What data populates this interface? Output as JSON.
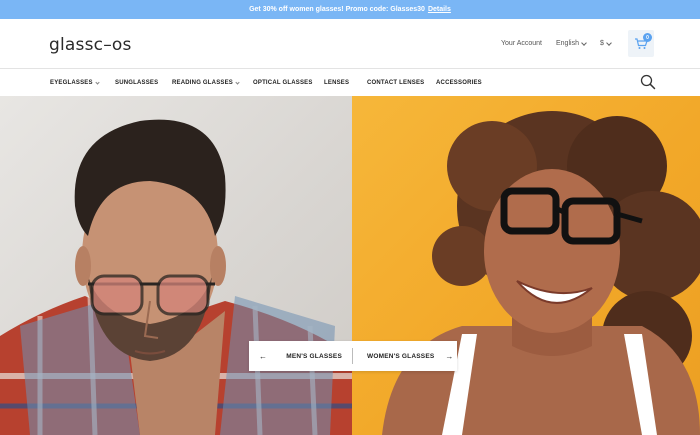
{
  "promo": {
    "text": "Get 30% off women glasses! Promo code: Glasses30",
    "link": "Details"
  },
  "header": {
    "logo": "glassc–os",
    "account": "Your Account",
    "language": "English",
    "currency": "$",
    "cart_count": "0"
  },
  "nav": {
    "items": [
      {
        "label": "EYEGLASSES",
        "dropdown": true
      },
      {
        "label": "SUNGLASSES",
        "dropdown": false
      },
      {
        "label": "READING GLASSES",
        "dropdown": true
      },
      {
        "label": "OPTICAL GLASSES",
        "dropdown": false
      },
      {
        "label": "LENSES",
        "dropdown": false
      },
      {
        "label": "CONTACT LENSES",
        "dropdown": false
      },
      {
        "label": "ACCESSORIES",
        "dropdown": false
      }
    ]
  },
  "hero": {
    "left_button": "MEN'S GLASSES",
    "left_arrow": "←",
    "right_button": "WOMEN'S GLASSES",
    "right_arrow": "→"
  },
  "colors": {
    "promo_bg": "#7ab6f5",
    "hero_left_bg": "#dcd9d5",
    "hero_right_bg": "#f2a829",
    "cart_badge": "#5aa2f0"
  },
  "icons": {
    "cart": "cart-icon",
    "search": "search-icon"
  }
}
